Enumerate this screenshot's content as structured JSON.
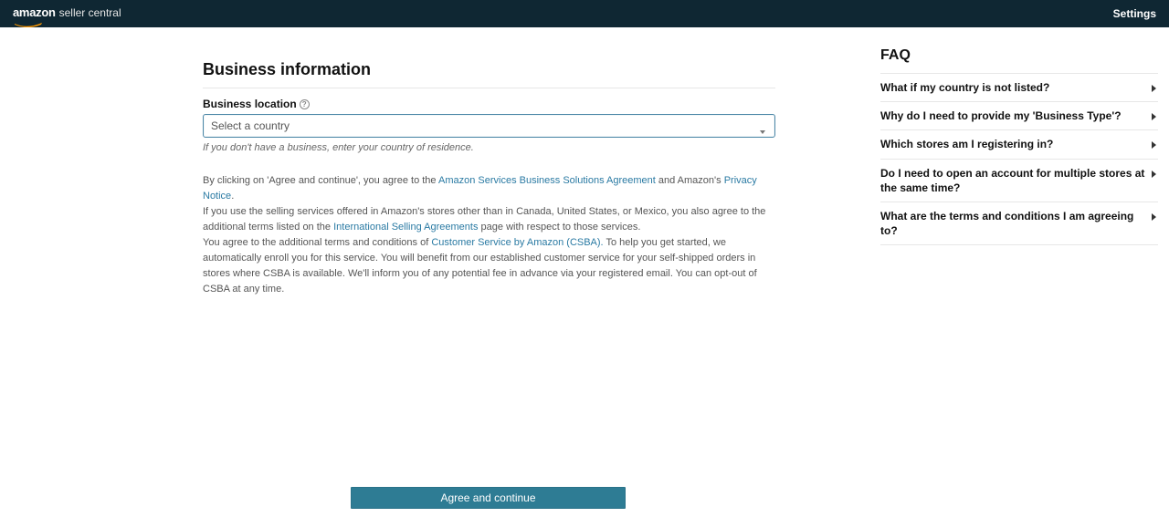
{
  "header": {
    "logo_primary": "amazon",
    "logo_secondary": "seller central",
    "settings_label": "Settings"
  },
  "page": {
    "title": "Business information",
    "location_label": "Business location",
    "country_select_placeholder": "Select a country",
    "hint": "If you don't have a business, enter your country of residence.",
    "legal_parts": {
      "l1_a": "By clicking on 'Agree and continue', you agree to the ",
      "l1_link1": "Amazon Services Business Solutions Agreement",
      "l1_b": " and Amazon's ",
      "l1_link2": "Privacy Notice",
      "l1_c": ".",
      "l2_a": "If you use the selling services offered in Amazon's stores other than in Canada, United States, or Mexico, you also agree to the additional terms listed on the ",
      "l2_link": "International Selling Agreements",
      "l2_b": " page with respect to those services.",
      "l3_a": "You agree to the additional terms and conditions of ",
      "l3_link": "Customer Service by Amazon (CSBA).",
      "l3_b": " To help you get started, we automatically enroll you for this service. You will benefit from our established customer service for your self-shipped orders in stores where CSBA is available. We'll inform you of any potential fee in advance via your registered email. You can opt-out of CSBA at any time."
    },
    "agree_button": "Agree and continue"
  },
  "faq": {
    "title": "FAQ",
    "items": [
      "What if my country is not listed?",
      "Why do I need to provide my 'Business Type'?",
      "Which stores am I registering in?",
      "Do I need to open an account for multiple stores at the same time?",
      "What are the terms and conditions I am agreeing to?"
    ]
  }
}
